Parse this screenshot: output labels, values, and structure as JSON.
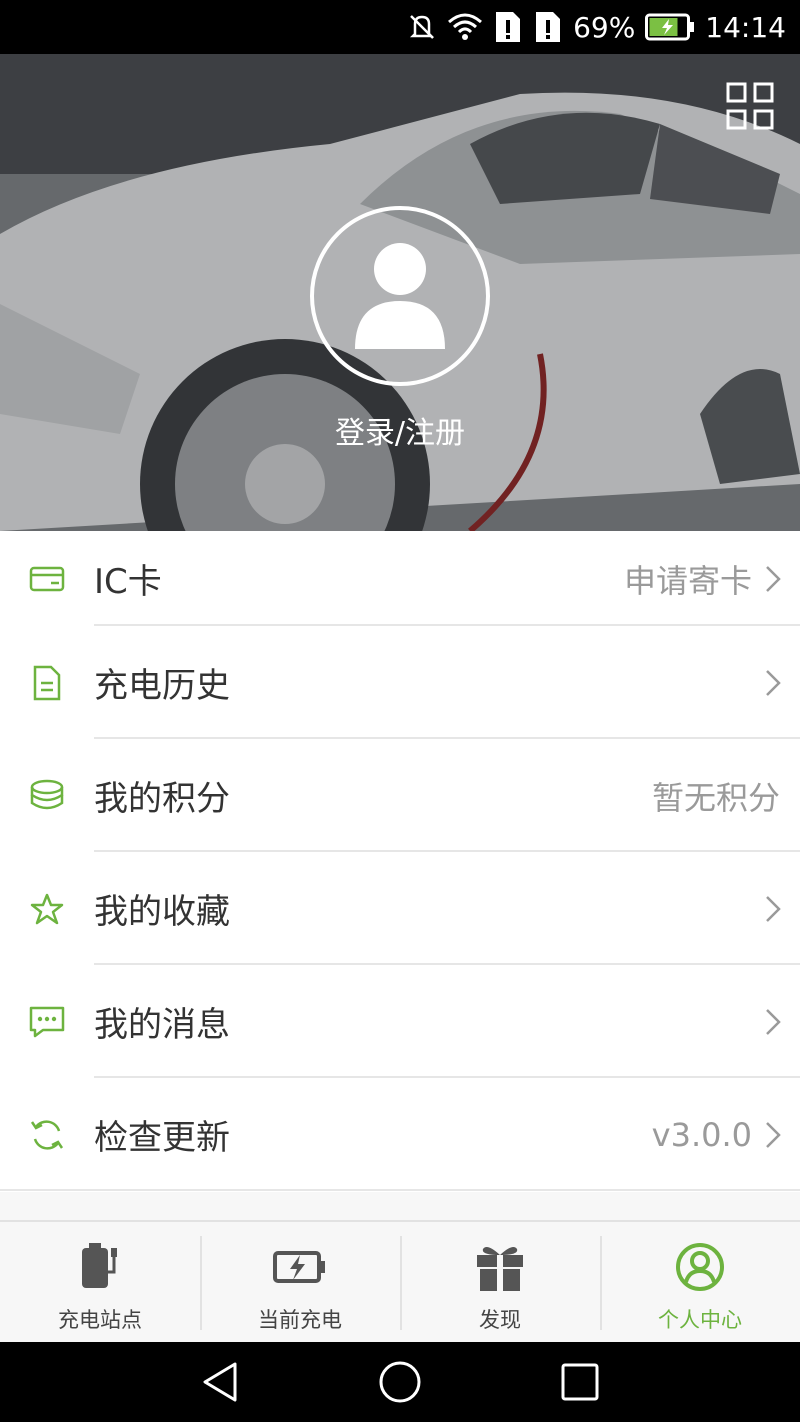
{
  "status_bar": {
    "battery_percent": "69%",
    "time": "14:14"
  },
  "hero": {
    "login_label": "登录/注册"
  },
  "menu": {
    "ic_card": {
      "label": "IC卡",
      "value": "申请寄卡"
    },
    "charging_history": {
      "label": "充电历史"
    },
    "points": {
      "label": "我的积分",
      "value": "暂无积分"
    },
    "favorites": {
      "label": "我的收藏"
    },
    "messages": {
      "label": "我的消息"
    },
    "update": {
      "label": "检查更新",
      "value": "v3.0.0"
    }
  },
  "bottom_nav": {
    "stations": "充电站点",
    "current": "当前充电",
    "discover": "发现",
    "profile": "个人中心"
  },
  "colors": {
    "accent": "#6db33f",
    "text": "#333333",
    "secondary_text": "#9a9a9a"
  }
}
